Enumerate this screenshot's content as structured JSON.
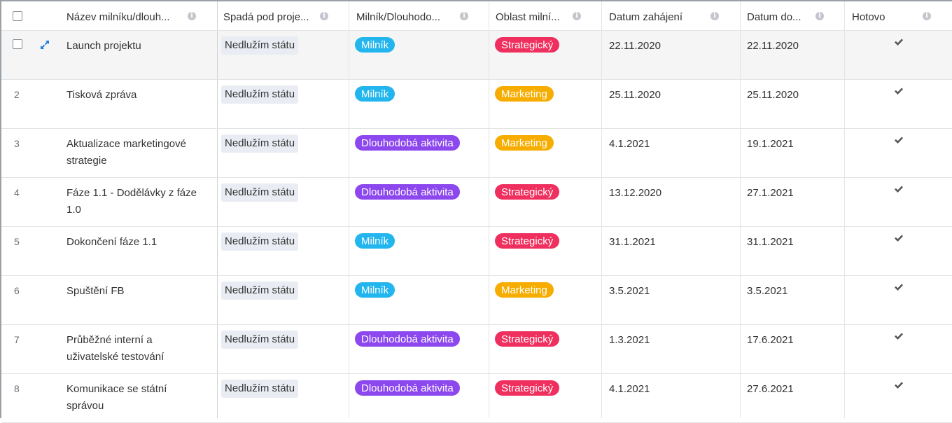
{
  "columns": [
    {
      "label": "Název milníku/dlouh..."
    },
    {
      "label": "Spadá pod proje..."
    },
    {
      "label": "Milník/Dlouhodo..."
    },
    {
      "label": "Oblast milní..."
    },
    {
      "label": "Datum zahájení"
    },
    {
      "label": "Datum do..."
    },
    {
      "label": "Hotovo"
    }
  ],
  "colors": {
    "Milník": "#22b5ee",
    "Dlouhodobá aktivita": "#8c47ee",
    "Strategický": "#ef2f5e",
    "Marketing": "#f6ad00",
    "check": "#555555"
  },
  "rows": [
    {
      "num": "",
      "name": "Launch projektu",
      "project": "Nedlužím státu",
      "type": "Milník",
      "area": "Strategický",
      "start": "22.11.2020",
      "end": "22.11.2020",
      "done": true
    },
    {
      "num": "2",
      "name": "Tisková zpráva",
      "project": "Nedlužím státu",
      "type": "Milník",
      "area": "Marketing",
      "start": "25.11.2020",
      "end": "25.11.2020",
      "done": true
    },
    {
      "num": "3",
      "name": "Aktualizace marketingové strategie",
      "project": "Nedlužím státu",
      "type": "Dlouhodobá aktivita",
      "area": "Marketing",
      "start": "4.1.2021",
      "end": "19.1.2021",
      "done": true
    },
    {
      "num": "4",
      "name": "Fáze 1.1 - Dodělávky z fáze 1.0",
      "project": "Nedlužím státu",
      "type": "Dlouhodobá aktivita",
      "area": "Strategický",
      "start": "13.12.2020",
      "end": "27.1.2021",
      "done": true
    },
    {
      "num": "5",
      "name": "Dokončení fáze 1.1",
      "project": "Nedlužím státu",
      "type": "Milník",
      "area": "Strategický",
      "start": "31.1.2021",
      "end": "31.1.2021",
      "done": true
    },
    {
      "num": "6",
      "name": "Spuštění FB",
      "project": "Nedlužím státu",
      "type": "Milník",
      "area": "Marketing",
      "start": "3.5.2021",
      "end": "3.5.2021",
      "done": true
    },
    {
      "num": "7",
      "name": "Průběžné interní a uživatelské testování",
      "project": "Nedlužím státu",
      "type": "Dlouhodobá aktivita",
      "area": "Strategický",
      "start": "1.3.2021",
      "end": "17.6.2021",
      "done": true
    },
    {
      "num": "8",
      "name": "Komunikace se státní správou",
      "project": "Nedlužím státu",
      "type": "Dlouhodobá aktivita",
      "area": "Strategický",
      "start": "4.1.2021",
      "end": "27.6.2021",
      "done": true
    }
  ]
}
